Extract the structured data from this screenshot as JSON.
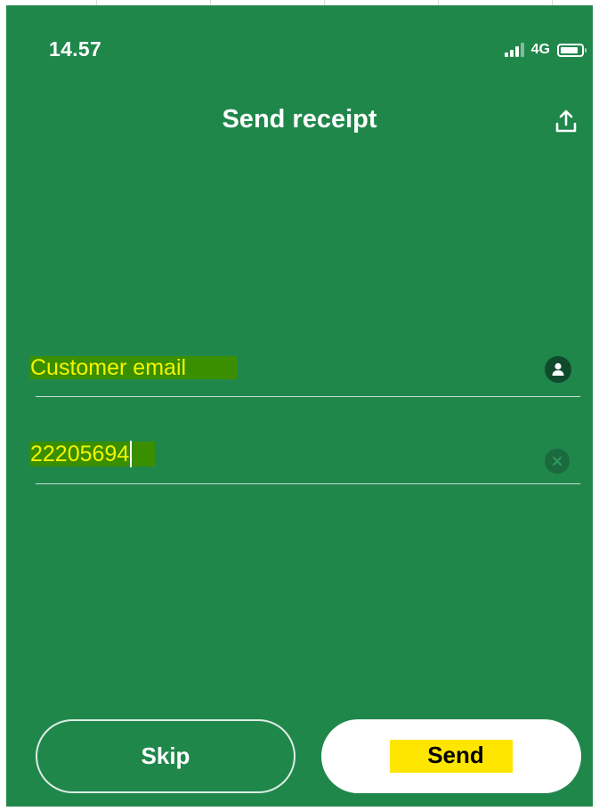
{
  "status_bar": {
    "time": "14.57",
    "network": "4G"
  },
  "header": {
    "title": "Send receipt"
  },
  "email_field": {
    "placeholder": "Customer email"
  },
  "value_field": {
    "value": "22205694"
  },
  "buttons": {
    "skip_label": "Skip",
    "send_label": "Send"
  },
  "icons": {
    "share": "share-icon",
    "contact": "person-icon",
    "clear": "clear-icon",
    "signal": "signal-icon",
    "battery": "battery-icon"
  },
  "colors": {
    "background": "#20874b",
    "input_text": "#f4f400",
    "highlight": "#3a8f00",
    "send_highlight": "#ffe600"
  }
}
